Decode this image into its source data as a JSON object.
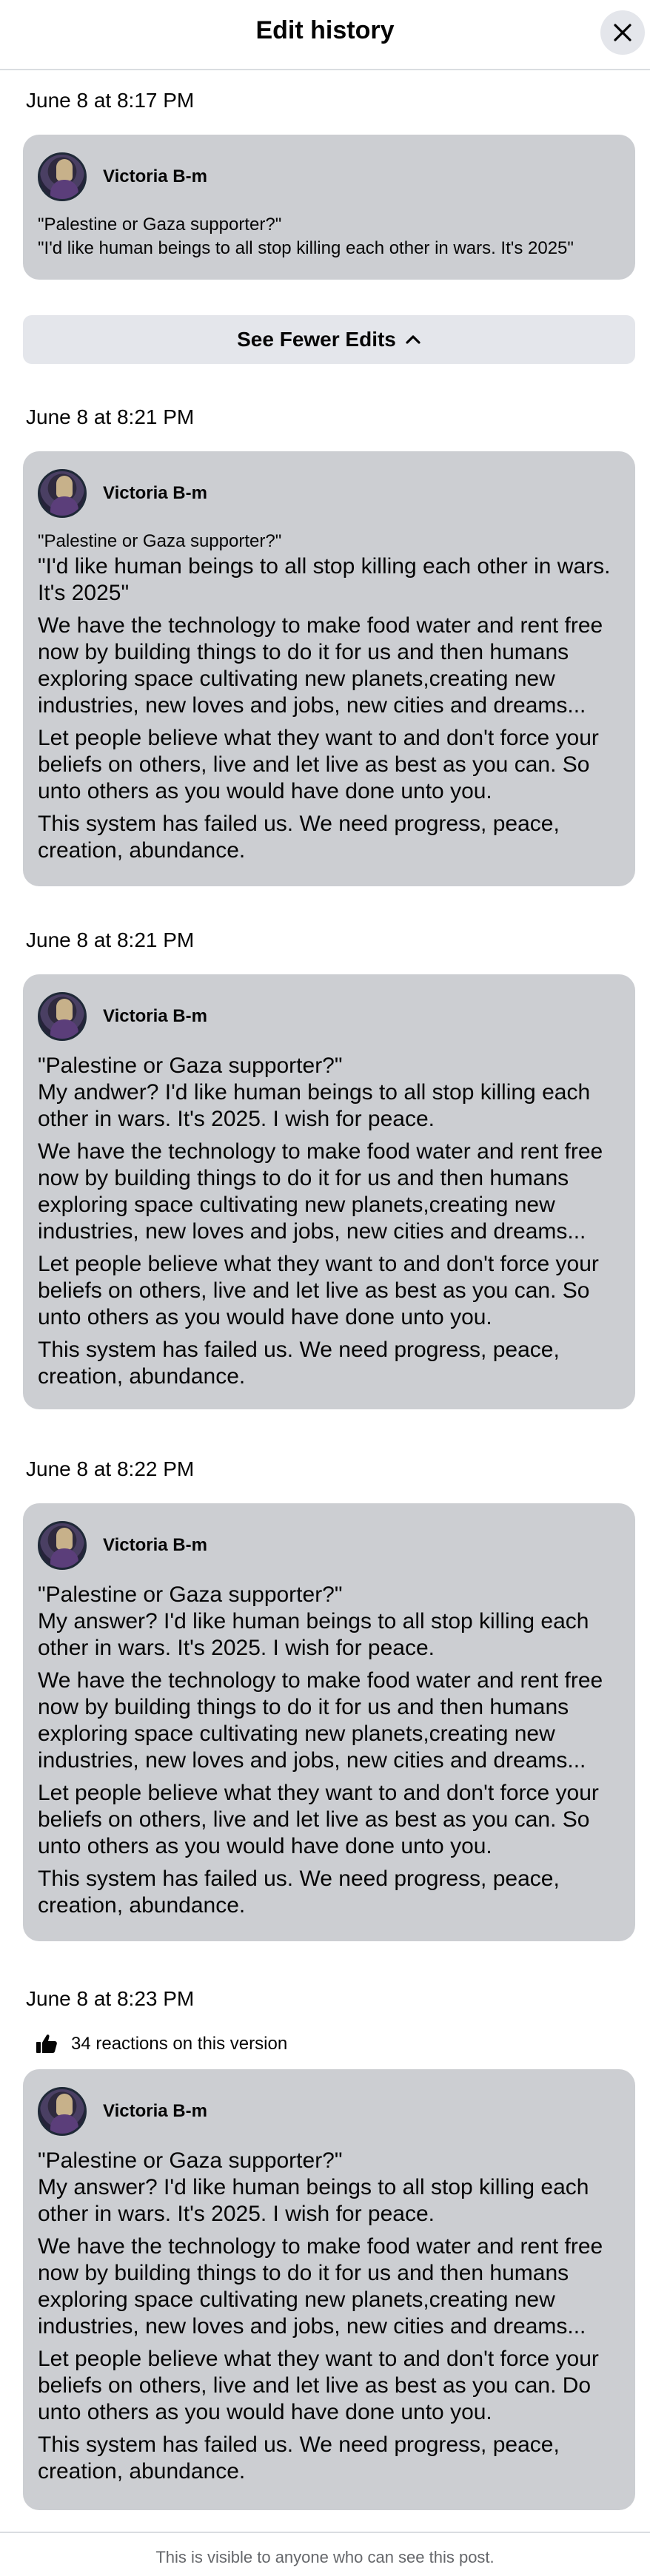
{
  "header": {
    "title": "Edit history"
  },
  "toggle": {
    "label": "See Fewer Edits"
  },
  "versions": [
    {
      "timestamp": "June 8 at 8:17 PM",
      "author": "Victoria B-m",
      "paragraphs": [
        "\"Palestine or Gaza supporter?\"\n\"I'd like human beings to all stop killing each other in wars. It's 2025\""
      ]
    },
    {
      "timestamp": "June 8 at 8:21 PM",
      "author": "Victoria B-m",
      "paragraphs": [
        "\"Palestine or Gaza supporter?\"",
        "\"I'd like human beings to all stop killing each other in wars.\nIt's 2025\"",
        "We have the technology to make food water and rent free\nnow by building things to do it for us and then humans\nexploring space cultivating new planets,creating new\nindustries, new loves and jobs, new cities and dreams...",
        "Let people believe what they want to and don't force your\nbeliefs on others, live and let live as best as you can. So\nunto others as you would have done unto you.",
        "This system has failed us. We need progress, peace,\ncreation, abundance."
      ]
    },
    {
      "timestamp": "June 8 at 8:21 PM",
      "author": "Victoria B-m",
      "paragraphs": [
        "\"Palestine or Gaza supporter?\"\nMy andwer? I'd like human beings to all stop killing each\nother in wars. It's 2025. I wish for peace.",
        "We have the technology to make food water and rent free\nnow by building things to do it for us and then humans\nexploring space cultivating new planets,creating new\nindustries, new loves and jobs, new cities and dreams...",
        "Let people believe what they want to and don't force your\nbeliefs on others, live and let live as best as you can. So\nunto others as you would have done unto you.",
        "This system has failed us. We need progress, peace,\ncreation, abundance."
      ]
    },
    {
      "timestamp": "June 8 at 8:22 PM",
      "author": "Victoria B-m",
      "paragraphs": [
        "\"Palestine or Gaza supporter?\"\nMy answer? I'd like human beings to all stop killing each\nother in wars. It's 2025. I wish for peace.",
        "We have the technology to make food water and rent free\nnow by building things to do it for us and then humans\nexploring space cultivating new planets,creating new\nindustries, new loves and jobs, new cities and dreams...",
        "Let people believe what they want to and don't force your\nbeliefs on others, live and let live as best as you can. So\nunto others as you would have done unto you.",
        "This system has failed us. We need progress, peace,\ncreation, abundance."
      ]
    },
    {
      "timestamp": "June 8 at 8:23 PM",
      "reactions": "34 reactions on this version",
      "author": "Victoria B-m",
      "paragraphs": [
        "\"Palestine or Gaza supporter?\"\nMy answer? I'd like human beings to all stop killing each\nother in wars. It's 2025. I wish for peace.",
        "We have the technology to make food water and rent free\nnow by building things to do it for us and then humans\nexploring space cultivating new planets,creating new\nindustries, new loves and jobs, new cities and dreams...",
        "Let people believe what they want to and don't force your\nbeliefs on others, live and let live as best as you can. Do\nunto others as you would have done unto you.",
        "This system has failed us. We need progress, peace,\ncreation, abundance."
      ]
    }
  ],
  "footer": {
    "text": "This is visible to anyone who can see this post."
  },
  "icons": {
    "close": "close-icon",
    "chevron": "chevron-up-icon",
    "like": "thumbs-up-icon"
  },
  "colors": {
    "card": "#ccced2",
    "button": "#e4e6eb",
    "muted_text": "#65676b"
  }
}
